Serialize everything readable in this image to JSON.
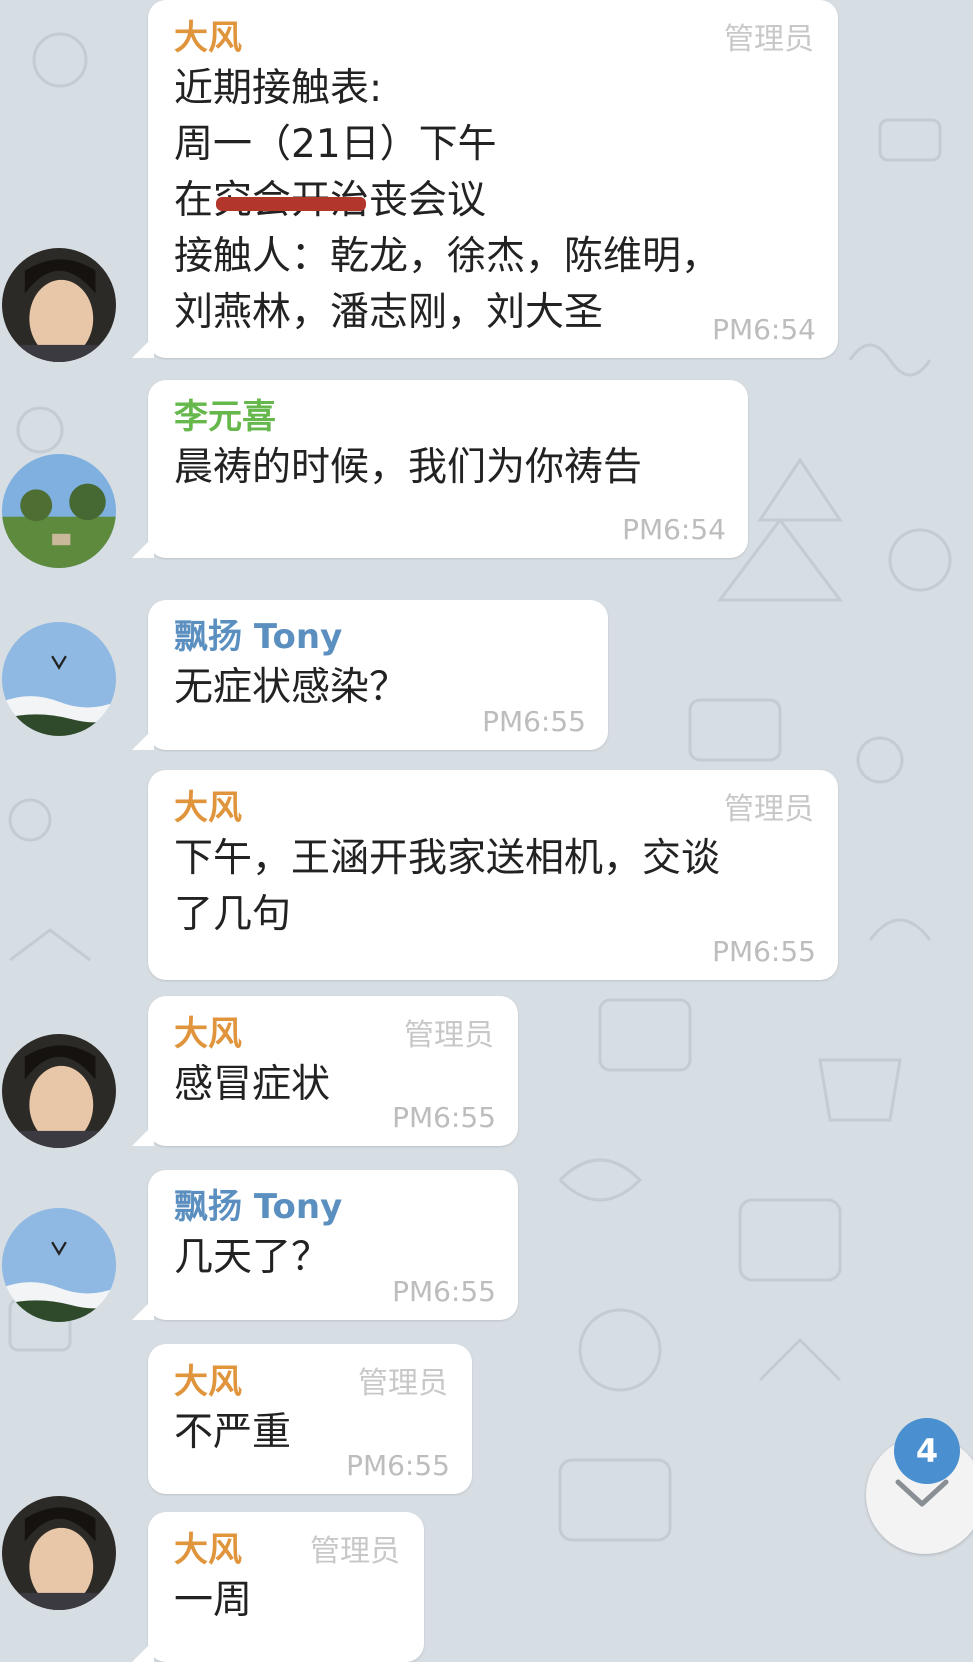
{
  "messages": [
    {
      "sender": "大风",
      "role": "管理员",
      "lines": [
        "近期接触表:",
        "周一（21日）下午",
        "在究会开治丧会议",
        "接触人：乾龙，徐杰，陈维明，",
        "刘燕林，潘志刚，刘大圣"
      ],
      "time": "PM6:54"
    },
    {
      "sender": "李元喜",
      "lines": [
        "晨祷的时候，我们为你祷告"
      ],
      "time": "PM6:54"
    },
    {
      "sender": "飘扬 Tony",
      "lines": [
        "无症状感染？"
      ],
      "time": "PM6:55"
    },
    {
      "sender": "大风",
      "role": "管理员",
      "lines": [
        "下午，王涵开我家送相机，交谈",
        "了几句"
      ],
      "time": "PM6:55"
    },
    {
      "sender": "大风",
      "role": "管理员",
      "lines": [
        "感冒症状"
      ],
      "time": "PM6:55"
    },
    {
      "sender": "飘扬 Tony",
      "lines": [
        "几天了？"
      ],
      "time": "PM6:55"
    },
    {
      "sender": "大风",
      "role": "管理员",
      "lines": [
        "不严重"
      ],
      "time": "PM6:55"
    },
    {
      "sender": "大风",
      "role": "管理员",
      "lines": [
        "一周"
      ],
      "time": ""
    }
  ],
  "unread_count": "4",
  "colors": {
    "background": "#d6dde3",
    "bubble": "#ffffff",
    "sender_admin": "#e0943c",
    "sender_green": "#66b84c",
    "sender_blue": "#5b8fc0",
    "badge": "#4a90d0"
  },
  "icons": {
    "scroll_down": "chevron-down-icon"
  }
}
